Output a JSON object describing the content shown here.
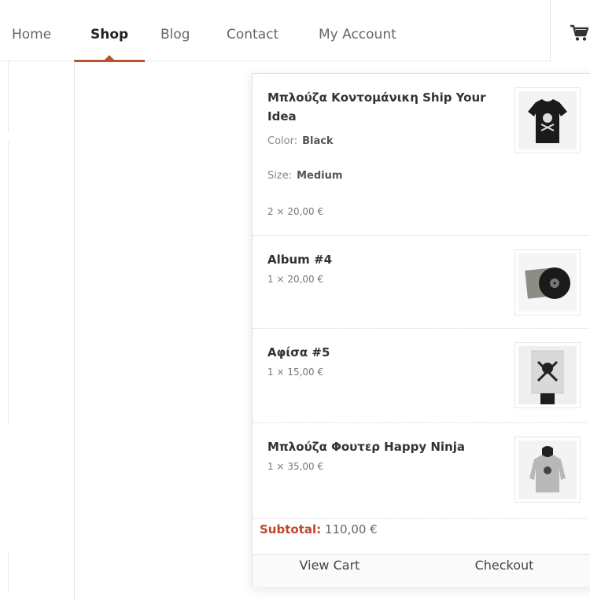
{
  "nav": {
    "items": [
      {
        "label": "Home"
      },
      {
        "label": "Shop"
      },
      {
        "label": "Blog"
      },
      {
        "label": "Contact"
      },
      {
        "label": "My Account"
      }
    ],
    "active": "Shop",
    "accent_color": "#b8532f",
    "cart_icon": "cart-icon"
  },
  "cart": {
    "items": [
      {
        "name": "Μπλούζα Κοντομάνικη Ship Your Idea",
        "meta": [
          {
            "label": "Color:",
            "value": "Black"
          },
          {
            "label": "Size:",
            "value": "Medium"
          }
        ],
        "price": "2 × 20,00 €",
        "icon": "tshirt-thumbnail"
      },
      {
        "name": "Album #4",
        "price": "1 × 20,00 €",
        "icon": "vinyl-album-thumbnail"
      },
      {
        "name": "Αφίσα #5",
        "price": "1 × 15,00 €",
        "icon": "poster-thumbnail"
      },
      {
        "name": "Μπλούζα Φουτερ Happy Ninja",
        "price": "1 × 35,00 €",
        "icon": "hoodie-thumbnail"
      }
    ],
    "subtotal_label": "Subtotal:",
    "subtotal_value": "110,00 €",
    "subtotal_color": "#c0482a",
    "view_cart_label": "View Cart",
    "checkout_label": "Checkout"
  }
}
